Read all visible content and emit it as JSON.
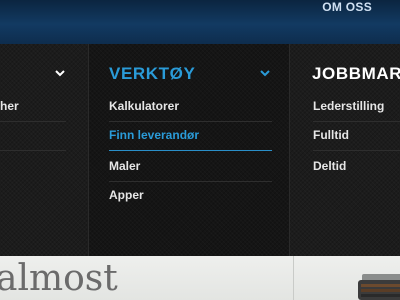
{
  "topbar": {
    "link_label": "OM OSS"
  },
  "menu": {
    "col1": {
      "items": [
        {
          "label": "her"
        }
      ]
    },
    "col2": {
      "heading": "VERKTØY",
      "heading_color": "#2a9bd8",
      "items": [
        {
          "label": "Kalkulatorer",
          "active": false
        },
        {
          "label": "Finn leverandør",
          "active": true
        },
        {
          "label": "Maler",
          "active": false
        },
        {
          "label": "Apper",
          "active": false
        }
      ],
      "accent_color": "#2a8fc9"
    },
    "col3": {
      "heading": "JOBBMAR",
      "items": [
        {
          "label": "Lederstilling"
        },
        {
          "label": "Fulltid"
        },
        {
          "label": "Deltid"
        }
      ]
    }
  },
  "hero": {
    "text": "almost"
  },
  "icons": {
    "dropdown": "chevron-down-icon",
    "machine": "typewriter-image"
  }
}
